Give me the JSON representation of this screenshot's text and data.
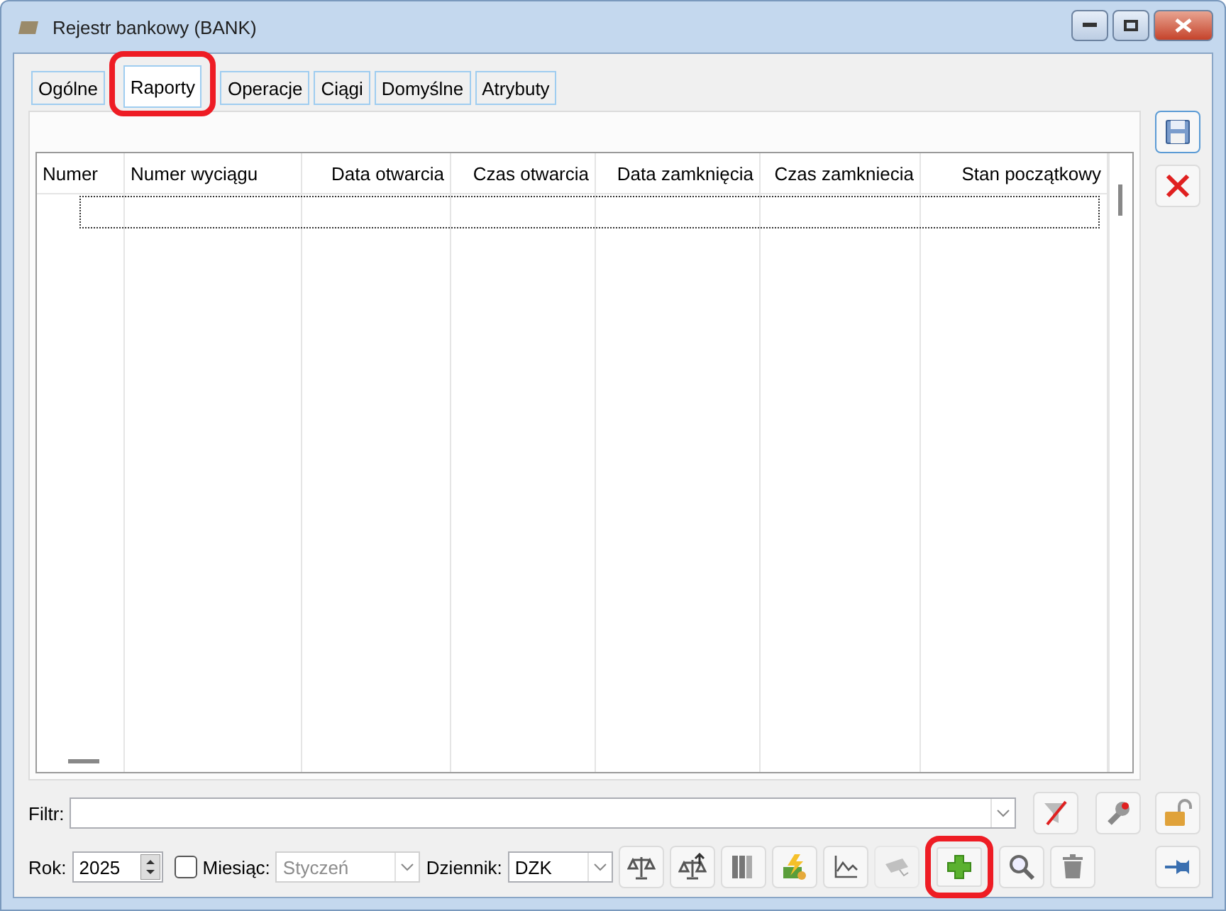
{
  "window": {
    "title": "Rejestr bankowy (BANK)"
  },
  "tabs": [
    {
      "label": "Ogólne",
      "selected": false,
      "highlighted": false
    },
    {
      "label": "Raporty",
      "selected": true,
      "highlighted": true
    },
    {
      "label": "Operacje",
      "selected": false,
      "highlighted": false
    },
    {
      "label": "Ciągi",
      "selected": false,
      "highlighted": false
    },
    {
      "label": "Domyślne",
      "selected": false,
      "highlighted": false
    },
    {
      "label": "Atrybuty",
      "selected": false,
      "highlighted": false
    }
  ],
  "table": {
    "columns": [
      {
        "label": "Numer"
      },
      {
        "label": "Numer wyciągu"
      },
      {
        "label": "Data otwarcia"
      },
      {
        "label": "Czas otwarcia"
      },
      {
        "label": "Data zamknięcia"
      },
      {
        "label": "Czas zamkniecia"
      },
      {
        "label": "Stan początkowy"
      }
    ]
  },
  "filter": {
    "label": "Filtr:"
  },
  "year": {
    "label": "Rok:",
    "value": "2025"
  },
  "month": {
    "label": "Miesiąc:",
    "checked": false,
    "value": "Styczeń",
    "disabled": true
  },
  "journal": {
    "label": "Dziennik:",
    "value": "DZK"
  },
  "filter_buttons": [
    {
      "kind": "clear-filter"
    },
    {
      "kind": "wrench"
    }
  ],
  "toolbar": [
    {
      "kind": "scales",
      "disabled": false,
      "highlighted": false
    },
    {
      "kind": "scales-up",
      "disabled": false,
      "highlighted": false
    },
    {
      "kind": "binders",
      "disabled": false,
      "highlighted": false
    },
    {
      "kind": "money",
      "disabled": false,
      "highlighted": false
    },
    {
      "kind": "chart",
      "disabled": false,
      "highlighted": false
    },
    {
      "kind": "tool",
      "disabled": true,
      "highlighted": false
    },
    {
      "kind": "add",
      "disabled": false,
      "highlighted": true
    },
    {
      "kind": "search",
      "disabled": false,
      "highlighted": false
    },
    {
      "kind": "trash",
      "disabled": false,
      "highlighted": false
    }
  ],
  "side_top": [
    {
      "kind": "save"
    },
    {
      "kind": "cancel"
    }
  ],
  "side_bottom": [
    {
      "kind": "lock"
    },
    {
      "kind": "pin"
    }
  ]
}
